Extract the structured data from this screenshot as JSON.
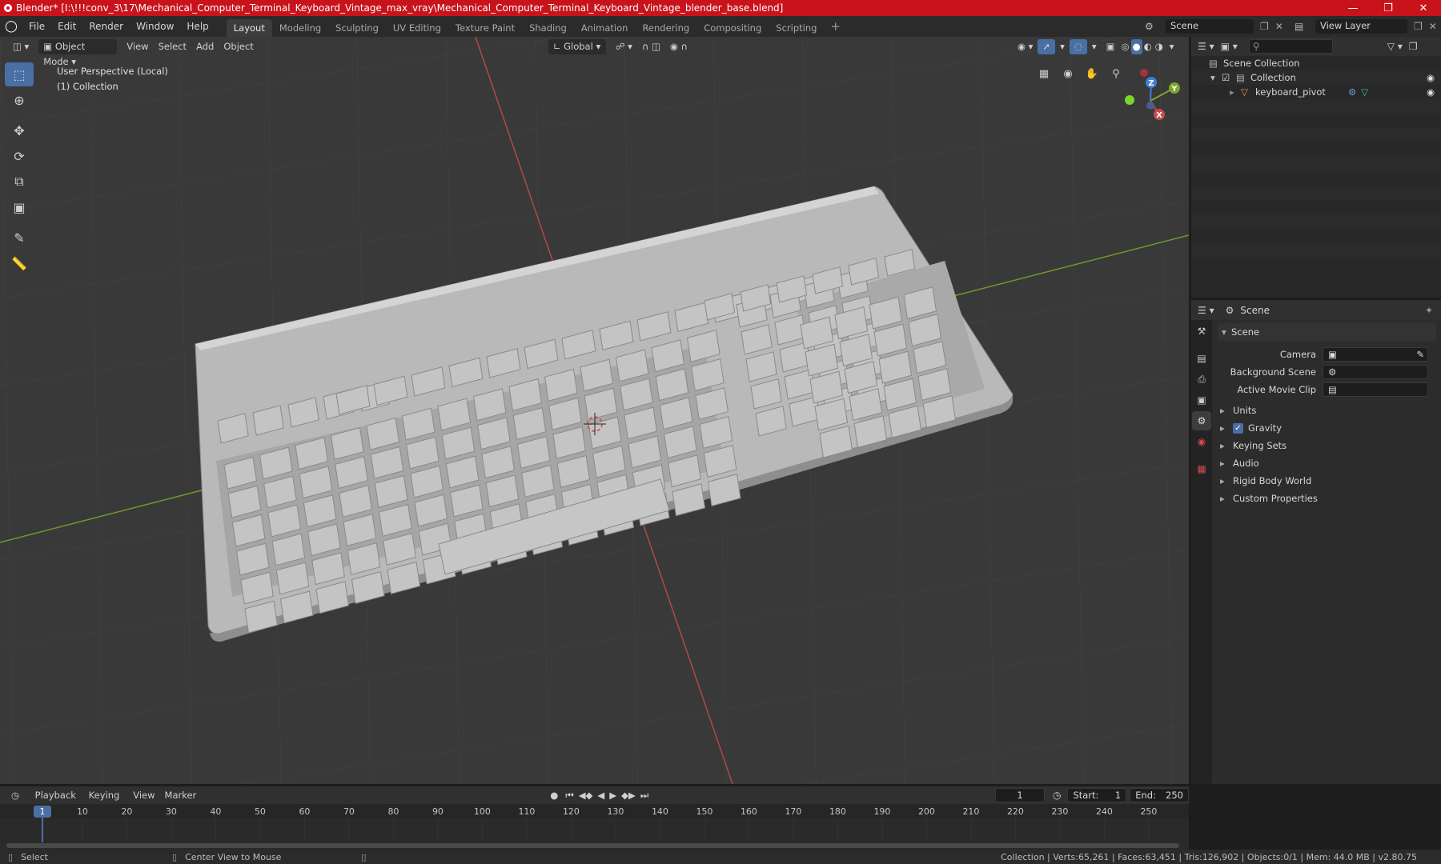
{
  "window": {
    "title": "Blender* [I:\\!!!conv_3\\17\\Mechanical_Computer_Terminal_Keyboard_Vintage_max_vray\\Mechanical_Computer_Terminal_Keyboard_Vintage_blender_base.blend]",
    "controls": [
      "minimize-icon",
      "maximize-icon",
      "close-icon"
    ]
  },
  "menu": {
    "items": [
      "File",
      "Edit",
      "Render",
      "Window",
      "Help"
    ],
    "workspaces": [
      "Layout",
      "Modeling",
      "Sculpting",
      "UV Editing",
      "Texture Paint",
      "Shading",
      "Animation",
      "Rendering",
      "Compositing",
      "Scripting"
    ],
    "active_workspace": "Layout",
    "scene_label": "Scene",
    "view_layer_label": "View Layer"
  },
  "viewport_header": {
    "mode": "Object Mode",
    "menus": [
      "View",
      "Select",
      "Add",
      "Object"
    ],
    "transform_orientation": "Global"
  },
  "viewport": {
    "perspective_label": "User Perspective (Local)",
    "collection_label": "(1) Collection",
    "gizmo_axes": [
      "Z",
      "Y",
      "X"
    ]
  },
  "outliner": {
    "root": "Scene Collection",
    "collection": "Collection",
    "object": "keyboard_pivot"
  },
  "properties": {
    "context": "Scene",
    "section": "Scene",
    "camera_label": "Camera",
    "background_scene_label": "Background Scene",
    "active_clip_label": "Active Movie Clip",
    "panels": [
      "Units",
      "Gravity",
      "Keying Sets",
      "Audio",
      "Rigid Body World",
      "Custom Properties"
    ],
    "gravity_checked": true
  },
  "timeline": {
    "menus": [
      "Playback",
      "Keying",
      "View",
      "Marker"
    ],
    "current_frame": "1",
    "start_label": "Start:",
    "start": "1",
    "end_label": "End:",
    "end": "250",
    "ruler": [
      "1",
      "10",
      "20",
      "30",
      "40",
      "50",
      "60",
      "70",
      "80",
      "90",
      "100",
      "110",
      "120",
      "130",
      "140",
      "150",
      "160",
      "170",
      "180",
      "190",
      "200",
      "210",
      "220",
      "230",
      "240",
      "250"
    ]
  },
  "status_bar": {
    "select": "Select",
    "center": "Center View to Mouse",
    "stats": "Collection | Verts:65,261 | Faces:63,451 | Tris:126,902 | Objects:0/1 | Mem: 44.0 MB | v2.80.75"
  },
  "colors": {
    "title_bar": "#c8131b",
    "accent": "#4a6fa5",
    "x_axis": "#c84a4a",
    "y_axis": "#7ba52a",
    "z_axis": "#3d7fd6"
  }
}
